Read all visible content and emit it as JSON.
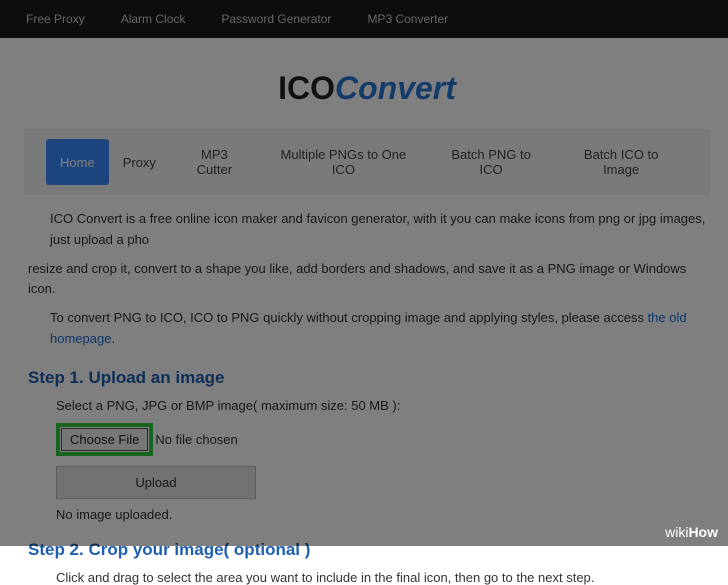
{
  "topnav": {
    "items": [
      {
        "label": "Free Proxy"
      },
      {
        "label": "Alarm Clock"
      },
      {
        "label": "Password Generator"
      },
      {
        "label": "MP3 Converter"
      }
    ]
  },
  "logo": {
    "part1": "ICO",
    "part2": "Convert"
  },
  "tabs": {
    "items": [
      {
        "label": "Home",
        "active": true
      },
      {
        "label": "Proxy"
      },
      {
        "label": "MP3 Cutter"
      },
      {
        "label": "Multiple PNGs to One ICO"
      },
      {
        "label": "Batch PNG to ICO"
      },
      {
        "label": "Batch ICO to Image"
      }
    ]
  },
  "desc": {
    "line1": "ICO Convert is a free online icon maker and favicon generator, with it you can make icons from png or jpg images, just upload a pho",
    "line2": "resize and crop it, convert to a shape you like, add borders and shadows, and save it as a PNG image or Windows icon.",
    "line3_pre": "To convert PNG to ICO, ICO to PNG quickly without cropping image and applying styles, please access ",
    "line3_link": "the old homepage",
    "line3_post": "."
  },
  "step1": {
    "title": "Step 1. Upload an image",
    "sub": "Select a PNG, JPG or BMP image( maximum size: 50 MB ):",
    "choose_label": "Choose File",
    "nofile": "No file chosen",
    "upload_label": "Upload",
    "noimage": "No image uploaded."
  },
  "step2": {
    "title": "Step 2. Crop your image( optional )",
    "sub": "Click and drag to select the area you want to include in the final icon, then go to the next step."
  },
  "watermark": {
    "wiki": "wiki",
    "how": "How"
  }
}
